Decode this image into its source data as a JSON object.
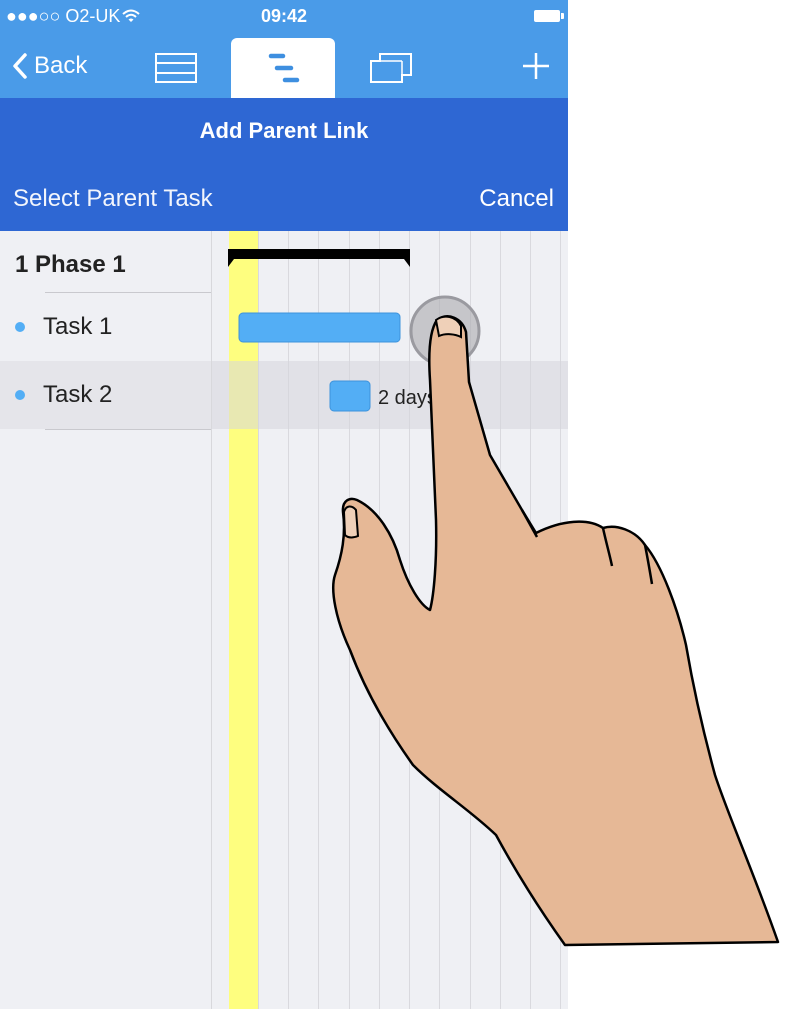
{
  "status_bar": {
    "carrier": "●●●○○ O2-UK",
    "time": "09:42"
  },
  "toolbar": {
    "back_label": "Back",
    "tabs": [
      {
        "icon": "list-view-icon"
      },
      {
        "icon": "gantt-view-icon",
        "selected": true
      },
      {
        "icon": "board-view-icon"
      }
    ],
    "add_icon": "plus-icon"
  },
  "header": {
    "title": "Add Parent Link",
    "subtitle": "Select Parent Task",
    "cancel_label": "Cancel"
  },
  "tasks": [
    {
      "label": "1 Phase 1",
      "type": "phase"
    },
    {
      "label": "Task 1",
      "type": "task"
    },
    {
      "label": "Task 2",
      "type": "task",
      "selected": true
    }
  ],
  "gantt": {
    "task2_bar_label": "2 days"
  },
  "colors": {
    "toolbar": "#4a9be8",
    "header": "#2e67d3",
    "task_bar": "#53aef5",
    "today_column": "#fefe7f",
    "hand": "#e6b896"
  }
}
